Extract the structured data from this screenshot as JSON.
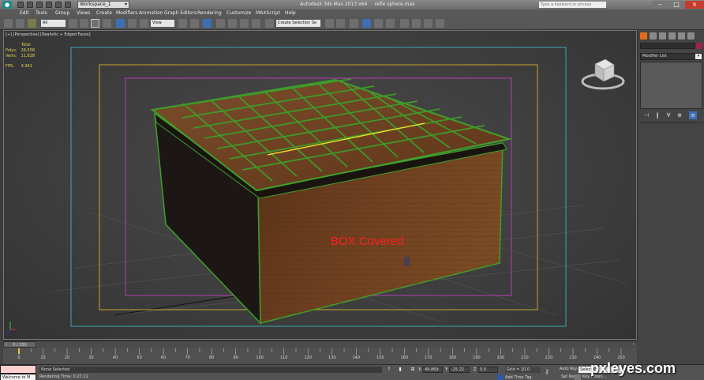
{
  "titlebar": {
    "workspace": "Workspace_1",
    "app_title": "Autodesk 3ds Max 2013 x64",
    "file_name": "refle sphere.max",
    "search_placeholder": "Type a keyword or phrase"
  },
  "menu": [
    "Edit",
    "Tools",
    "Group",
    "Views",
    "Create",
    "Modifiers",
    "Animation",
    "Graph Editors",
    "Rendering",
    "Customize",
    "MAXScript",
    "Help"
  ],
  "toolbar": {
    "selection_filter": "All",
    "reference_coord": "View",
    "named_selection": "Create Selection Se"
  },
  "viewport": {
    "label": "[+] [Perspective] [Realistic + Edged Faces]",
    "stats": {
      "header": "Total",
      "polys_label": "Polys:",
      "polys": "26,558",
      "verts_label": "Verts:",
      "verts": "11,828",
      "fps_label": "FPS:",
      "fps": "3.941"
    },
    "annotation": "BOX Covered"
  },
  "command_panel": {
    "modifier_list": "Modifier List",
    "object_color": "#a0204e"
  },
  "timeline": {
    "thumb_label": "0 / 250",
    "ticks": [
      "0",
      "10",
      "20",
      "30",
      "40",
      "50",
      "60",
      "70",
      "80",
      "90",
      "100",
      "110",
      "120",
      "130",
      "140",
      "150",
      "160",
      "170",
      "180",
      "190",
      "200",
      "210",
      "220",
      "230",
      "240",
      "250"
    ],
    "current_frame": 0,
    "total_frames": 250
  },
  "statusbar": {
    "maxscript_mini": "",
    "maxscript_welcome": "Welcome to M",
    "selection_status": "None Selected",
    "render_status": "Rendering Time: 0:27:22",
    "x_label": "X:",
    "x_value": "49.869",
    "y_label": "Y:",
    "y_value": "-25.22",
    "z_label": "Z:",
    "z_value": "0.0",
    "grid": "Grid = 10.0",
    "add_time_tag": "Add Time Tag",
    "auto_key": "Auto Key",
    "set_key": "Set Key",
    "selected_mode": "Selected",
    "key_filters": "Key Filters..."
  },
  "watermark": "pxleyes.com"
}
